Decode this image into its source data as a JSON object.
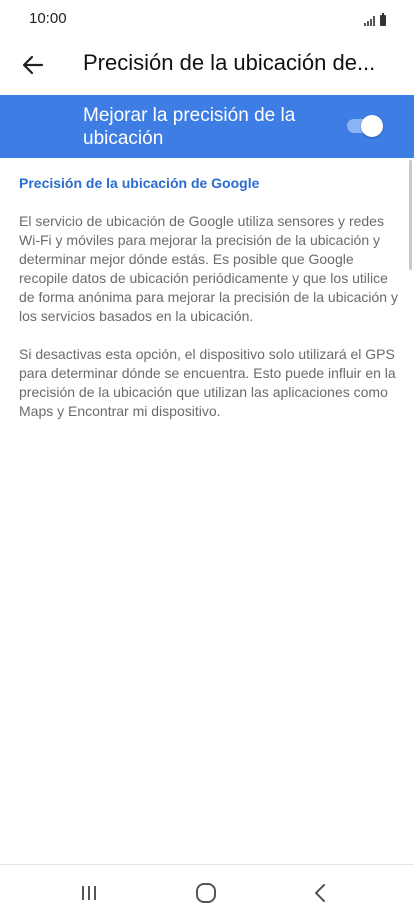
{
  "status_bar": {
    "time": "10:00",
    "signal_icon": "signal-icon",
    "battery_icon": "battery-icon"
  },
  "app_bar": {
    "back_icon": "arrow-left-icon",
    "title": "Precisión de la ubicación de..."
  },
  "main_switch": {
    "label": "Mejorar la precisión de la ubicación",
    "enabled": true,
    "color": "#3d7de4"
  },
  "section": {
    "header": "Precisión de la ubicación de Google",
    "header_color": "#2a6ccf",
    "paragraphs": [
      "El servicio de ubicación de Google utiliza sensores y redes Wi-Fi y móviles para mejorar la precisión de la ubicación y determinar mejor dónde estás. Es posible que Google recopile datos de ubicación periódicamente y que los utilice de forma anónima para mejorar la precisión de la ubicación y los servicios basados en la ubicación.",
      "Si desactivas esta opción, el dispositivo solo utilizará el GPS para determinar dónde se encuentra. Esto puede influir en la precisión de la ubicación que utilizan las aplicaciones como Maps y Encontrar mi dispositivo."
    ]
  },
  "nav_bar": {
    "recents_icon": "recents-icon",
    "home_icon": "home-icon",
    "back_icon": "chevron-left-icon"
  }
}
